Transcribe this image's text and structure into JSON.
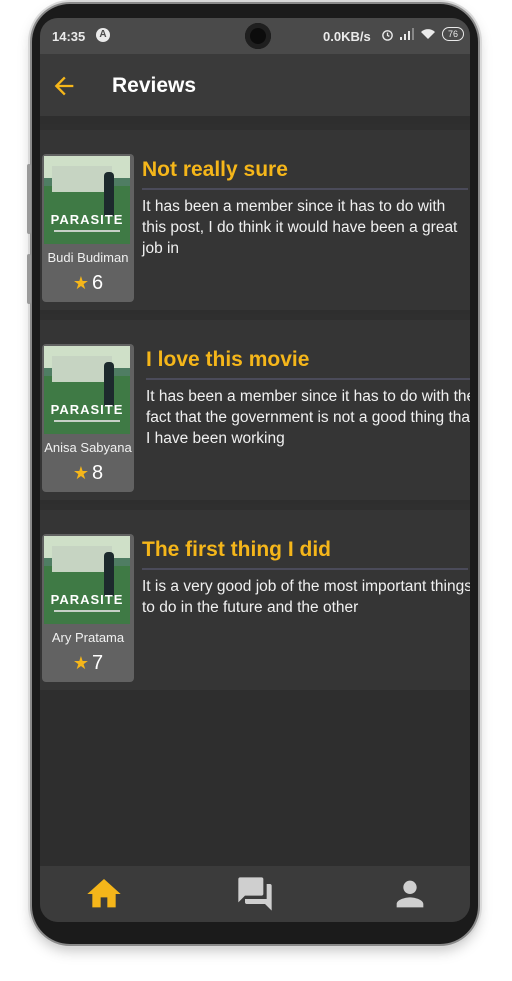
{
  "status_bar": {
    "time": "14:35",
    "network_speed": "0.0KB/s",
    "battery": "76",
    "icons": [
      "a-badge-icon",
      "alarm-icon",
      "signal-icon",
      "wifi-icon",
      "battery-icon"
    ]
  },
  "app_bar": {
    "title": "Reviews",
    "back_icon": "arrow-left-icon"
  },
  "colors": {
    "accent": "#f5b61a",
    "background": "#2e2e2e",
    "card": "#353535",
    "text": "#f0f0f0"
  },
  "reviews": [
    {
      "title": "Not really sure",
      "body": "It has been a member since it has to do with this post, I do think it would have been a great job in",
      "reviewer": "Budi Budiman",
      "rating": "6",
      "poster_word": "PARASITE"
    },
    {
      "title": "I love this movie",
      "body": "It has been a member since it has to do with the fact that the government is not a good thing that I have been working",
      "reviewer": "Anisa Sabyana",
      "rating": "8",
      "poster_word": "PARASITE"
    },
    {
      "title": "The first thing I did",
      "body": "It is a very good job of the most important things to do in the future and the other",
      "reviewer": "Ary Pratama",
      "rating": "7",
      "poster_word": "PARASITE"
    }
  ],
  "bottom_nav": {
    "items": [
      {
        "icon": "home-icon",
        "active": true
      },
      {
        "icon": "chat-icon",
        "active": false
      },
      {
        "icon": "profile-icon",
        "active": false
      }
    ]
  }
}
